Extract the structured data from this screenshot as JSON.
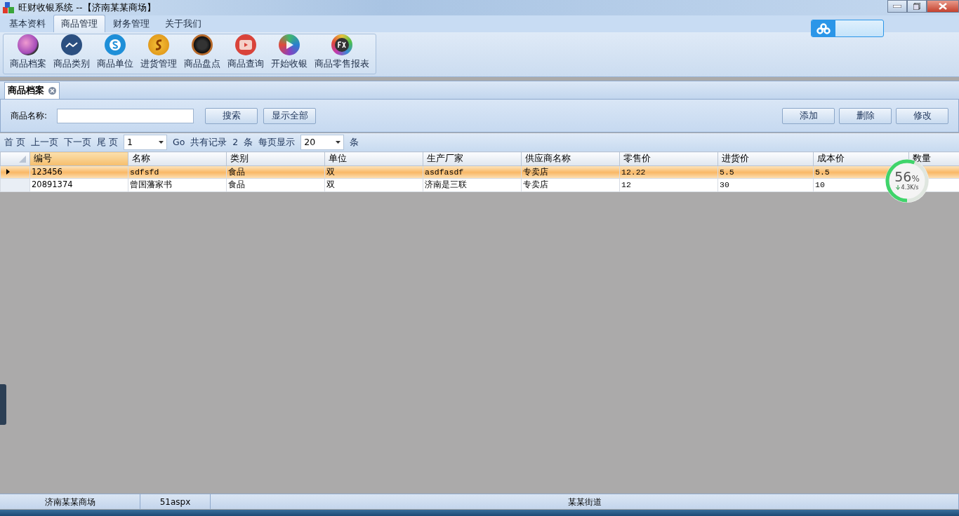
{
  "window": {
    "title": "旺财收银系统 --【济南某某商场】"
  },
  "menu_tabs": [
    {
      "label": "基本资料",
      "selected": false
    },
    {
      "label": "商品管理",
      "selected": true
    },
    {
      "label": "财务管理",
      "selected": false
    },
    {
      "label": "关于我们",
      "selected": false
    }
  ],
  "ribbon": [
    {
      "label": "商品档案"
    },
    {
      "label": "商品类别"
    },
    {
      "label": "商品单位"
    },
    {
      "label": "进货管理"
    },
    {
      "label": "商品盘点"
    },
    {
      "label": "商品查询"
    },
    {
      "label": "开始收银"
    },
    {
      "label": "商品零售报表"
    }
  ],
  "doc_tabs": [
    {
      "label": "商品档案",
      "selected": true
    }
  ],
  "search": {
    "label": "商品名称:",
    "buttons": [
      "搜索",
      "显示全部"
    ],
    "actions": [
      "添加",
      "删除",
      "修改"
    ]
  },
  "pager": {
    "first": "首 页",
    "prev": "上一页",
    "next": "下一页",
    "last": "尾 页",
    "page": "1",
    "go": "Go",
    "total_label": "共有记录",
    "total": "2",
    "unit": "条",
    "per_page_label": "每页显示",
    "per_page": "20",
    "per_page_unit": "条"
  },
  "table": {
    "columns": [
      "编号",
      "名称",
      "类别",
      "单位",
      "生产厂家",
      "供应商名称",
      "零售价",
      "进货价",
      "成本价",
      "数量"
    ],
    "rows": [
      {
        "selected": true,
        "cells": [
          "123456",
          "sdfsfd",
          "食品",
          "双",
          "asdfasdf",
          "专卖店",
          "12.22",
          "5.5",
          "5.5"
        ]
      },
      {
        "selected": false,
        "cells": [
          "20891374",
          "曾国藩家书",
          "食品",
          "双",
          "济南是三联",
          "专卖店",
          "12",
          "30",
          "10"
        ]
      }
    ]
  },
  "speed_widget": {
    "percent": "56",
    "percent_unit": "%",
    "speed": "4.3K/s",
    "level": 0.56
  },
  "status_bar": [
    "济南某某商场",
    "51aspx",
    "某某街道"
  ]
}
